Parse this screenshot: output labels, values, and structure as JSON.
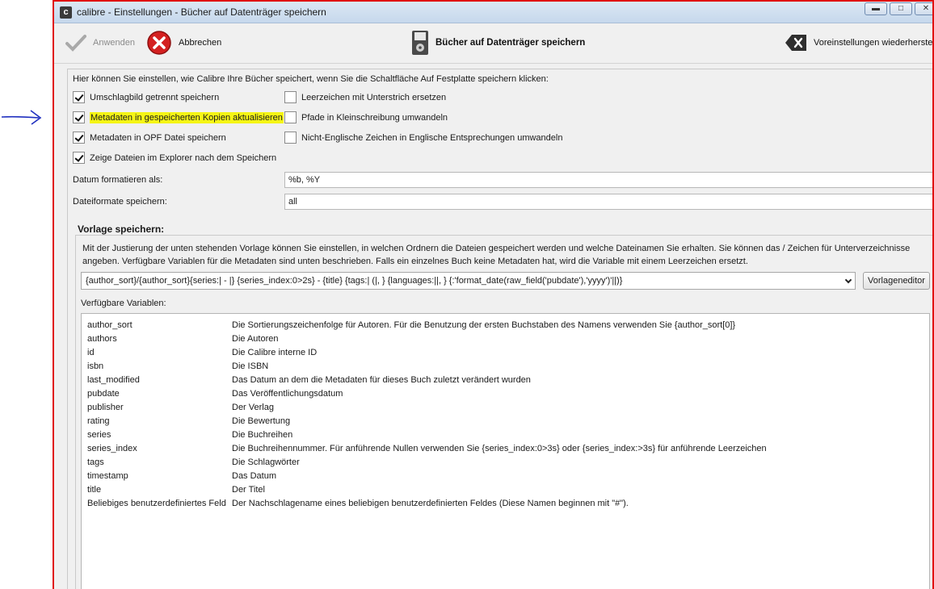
{
  "window": {
    "title": "calibre - Einstellungen - Bücher auf Datenträger speichern",
    "app_icon_glyph": "c"
  },
  "toolbar": {
    "apply_label": "Anwenden",
    "cancel_label": "Abbrechen",
    "section_title": "Bücher auf Datenträger speichern",
    "reset_label": "Voreinstellungen wiederherstellen"
  },
  "intro": "Hier können Sie einstellen, wie Calibre Ihre Bücher speichert, wenn Sie die Schaltfläche Auf Festplatte speichern klicken:",
  "options": [
    {
      "label": "Umschlagbild getrennt speichern",
      "checked": true
    },
    {
      "label": "Metadaten in gespeicherten Kopien aktualisieren",
      "checked": true
    },
    {
      "label": "Metadaten in OPF Datei speichern",
      "checked": true
    },
    {
      "label": "Zeige Dateien im Explorer nach dem Speichern",
      "checked": true
    },
    {
      "label": "Leerzeichen mit Unterstrich ersetzen",
      "checked": false
    },
    {
      "label": "Pfade in Kleinschreibung umwandeln",
      "checked": false
    },
    {
      "label": "Nicht-Englische Zeichen in Englische Entsprechungen umwandeln",
      "checked": false
    }
  ],
  "date_format": {
    "label": "Datum formatieren als:",
    "value": "%b, %Y"
  },
  "file_formats": {
    "label": "Dateiformate speichern:",
    "value": "all"
  },
  "template_group": {
    "title": "Vorlage speichern:",
    "description": "Mit der Justierung der unten stehenden Vorlage können Sie einstellen, in welchen Ordnern die Dateien gespeichert werden und welche Dateinamen Sie erhalten. Sie können das / Zeichen für Unterverzeichnisse angeben. Verfügbare Variablen für die Metadaten sind unten beschrieben. Falls ein einzelnes Buch keine Metadaten hat, wird die Variable mit einem Leerzeichen ersetzt.",
    "template_value": "{author_sort}/{author_sort}{series:| - |} {series_index:0>2s} - {title} {tags:| (|, } {languages:||, } {:'format_date(raw_field('pubdate'),'yyyy')'||)}",
    "editor_button": "Vorlageneditor",
    "vars_label": "Verfügbare Variablen:"
  },
  "variables": [
    {
      "name": "author_sort",
      "desc": "Die Sortierungszeichenfolge für Autoren. Für die Benutzung der ersten Buchstaben des Namens verwenden Sie {author_sort[0]}"
    },
    {
      "name": "authors",
      "desc": "Die Autoren"
    },
    {
      "name": "id",
      "desc": "Die Calibre interne ID"
    },
    {
      "name": "isbn",
      "desc": "Die ISBN"
    },
    {
      "name": "last_modified",
      "desc": "Das Datum an dem die Metadaten für dieses Buch zuletzt verändert wurden"
    },
    {
      "name": "pubdate",
      "desc": "Das Veröffentlichungsdatum"
    },
    {
      "name": "publisher",
      "desc": "Der Verlag"
    },
    {
      "name": "rating",
      "desc": "Die Bewertung"
    },
    {
      "name": "series",
      "desc": "Die Buchreihen"
    },
    {
      "name": "series_index",
      "desc": "Die Buchreihennummer. Für anführende Nullen verwenden Sie {series_index:0>3s} oder {series_index:>3s} für anführende Leerzeichen"
    },
    {
      "name": "tags",
      "desc": "Die Schlagwörter"
    },
    {
      "name": "timestamp",
      "desc": "Das Datum"
    },
    {
      "name": "title",
      "desc": "Der Titel"
    },
    {
      "name": "Beliebiges benutzerdefiniertes Feld",
      "desc": "Der Nachschlagename eines beliebigen benutzerdefinierten Feldes (Diese Namen beginnen mit \"#\")."
    }
  ],
  "colors": {
    "highlight": "#f5f515",
    "frame": "#e01010",
    "arrow": "#1f2fbf",
    "cancel_red": "#d42020"
  }
}
